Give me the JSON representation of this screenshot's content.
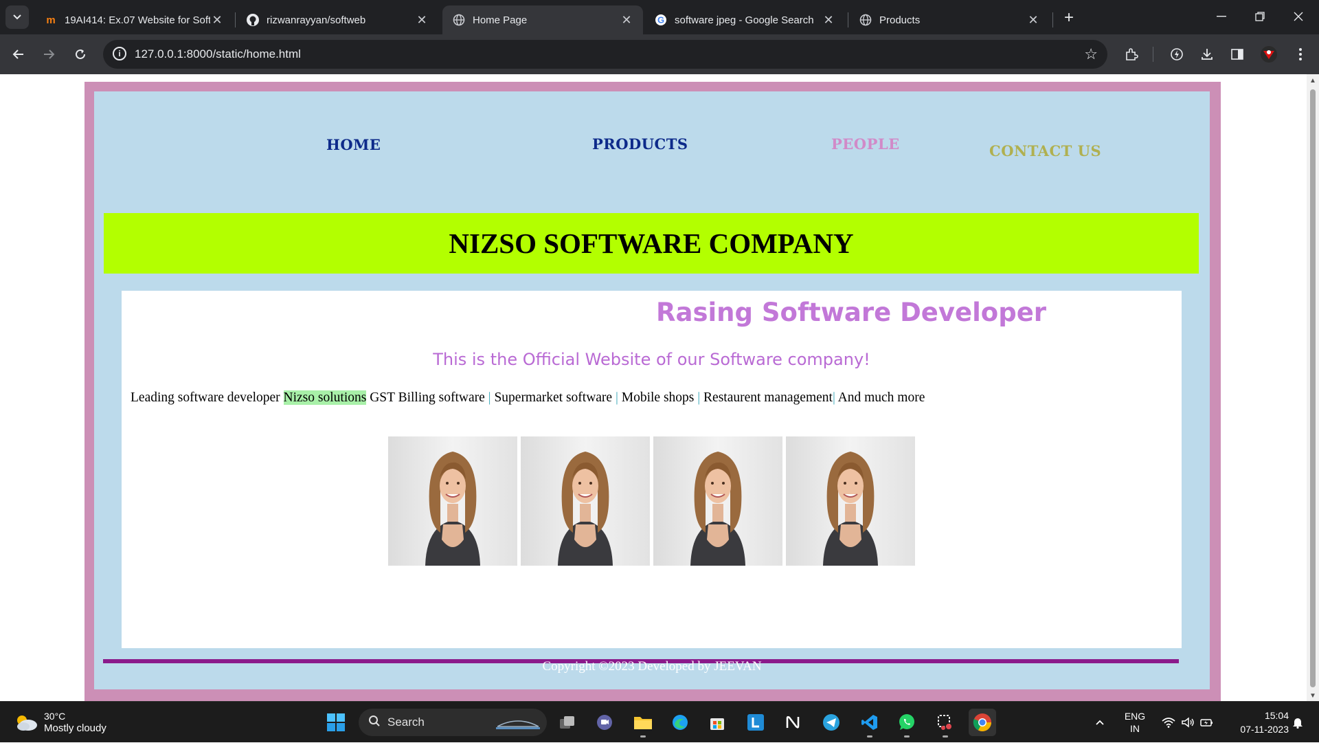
{
  "browser": {
    "tabs": [
      {
        "title": "19AI414: Ex.07 Website for Soft",
        "favicon": "moodle-icon",
        "active": false
      },
      {
        "title": "rizwanrayyan/softweb",
        "favicon": "github-icon",
        "active": false
      },
      {
        "title": "Home Page",
        "favicon": "globe-icon",
        "active": true
      },
      {
        "title": "software jpeg - Google Search",
        "favicon": "google-icon",
        "active": false
      },
      {
        "title": "Products",
        "favicon": "globe-icon",
        "active": false
      }
    ],
    "url": "127.0.0.1:8000/static/home.html"
  },
  "page": {
    "nav": {
      "home": "HOME",
      "products": "PRODUCTS",
      "people": "PEOPLE",
      "contact": "CONTACT US"
    },
    "nav_colors": {
      "home": "#0d2a8a",
      "products": "#0d2a8a",
      "people": "#d18ac8",
      "contact": "#b0b050"
    },
    "banner_title": "NIZSO SOFTWARE COMPANY",
    "tagline": "Rasing Software Developer",
    "official": "This is the Official Website of our Software company!",
    "services": {
      "prefix": "Leading software developer ",
      "highlight": "Nizso solutions",
      "item1": " GST Billing software ",
      "item2": " Supermarket software ",
      "item3": " Mobile shops ",
      "item4": " Restaurent management",
      "item5": " And much more",
      "separator": "|"
    },
    "gallery_count": 4,
    "copyright": "Copyright ©2023 Developed by JEEVAN"
  },
  "taskbar": {
    "weather_temp": "30°C",
    "weather_condition": "Mostly cloudy",
    "search_label": "Search",
    "lang_line1": "ENG",
    "lang_line2": "IN",
    "time": "15:04",
    "date": "07-11-2023"
  },
  "colors": {
    "outer_border": "#cc8fb6",
    "inner_bg": "#bcdaeb",
    "banner_bg": "#b3ff00",
    "tagline": "#c278d8",
    "footer_rule": "#8b1a8b"
  }
}
